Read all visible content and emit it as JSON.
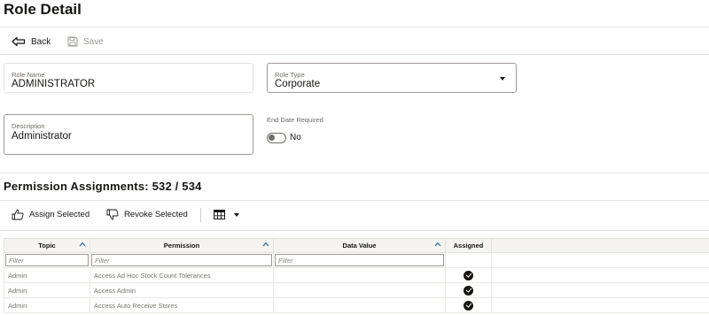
{
  "page": {
    "title": "Role Detail"
  },
  "toolbar": {
    "back_label": "Back",
    "save_label": "Save"
  },
  "role_name": {
    "label": "Role Name",
    "value": "ADMINISTRATOR"
  },
  "role_type": {
    "label": "Role Type",
    "value": "Corporate"
  },
  "description": {
    "label": "Description",
    "value": "Administrator"
  },
  "end_date": {
    "label": "End Date Required",
    "value": "No",
    "checked": false
  },
  "permissions": {
    "title": "Permission Assignments: 532 / 534",
    "assign_label": "Assign Selected",
    "revoke_label": "Revoke Selected",
    "columns": [
      "Topic",
      "Permission",
      "Data Value",
      "Assigned"
    ],
    "filter_placeholder": "Filter",
    "rows": [
      {
        "topic": "Admin",
        "permission": "Access Ad Hoc Stock Count Tolerances",
        "data_value": "",
        "assigned": true
      },
      {
        "topic": "Admin",
        "permission": "Access Admin",
        "data_value": "",
        "assigned": true
      },
      {
        "topic": "Admin",
        "permission": "Access Auto Receive Stores",
        "data_value": "",
        "assigned": true
      }
    ]
  },
  "colors": {
    "text": "#161513",
    "muted": "#6f6b66",
    "border": "#cfcbc6",
    "header_bg": "#f5f4f2"
  }
}
